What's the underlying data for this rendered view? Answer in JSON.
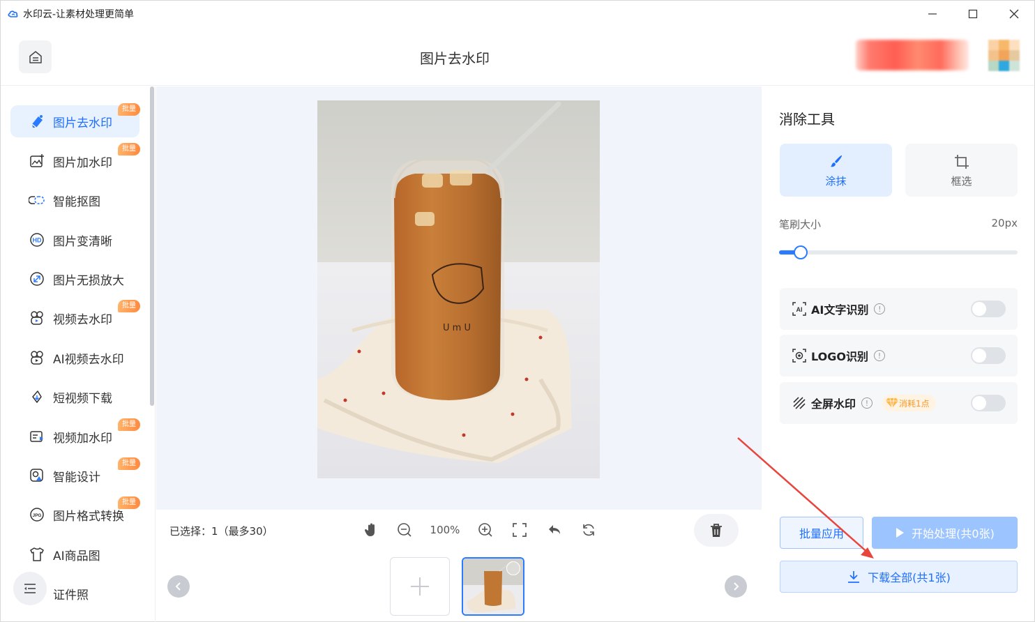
{
  "window": {
    "title": "水印云-让素材处理更简单",
    "controls": [
      "minimize-icon",
      "maximize-icon",
      "close-icon"
    ]
  },
  "header": {
    "page_title": "图片去水印",
    "home_icon": "home-icon"
  },
  "sidebar": {
    "items": [
      {
        "label": "图片去水印",
        "icon": "eraser-icon",
        "badge": "批量",
        "active": true
      },
      {
        "label": "图片加水印",
        "icon": "image-add-icon",
        "badge": "批量",
        "active": false
      },
      {
        "label": "智能抠图",
        "icon": "cutout-icon",
        "badge": "",
        "active": false
      },
      {
        "label": "图片变清晰",
        "icon": "hd-icon",
        "badge": "",
        "active": false
      },
      {
        "label": "图片无损放大",
        "icon": "enlarge-icon",
        "badge": "",
        "active": false
      },
      {
        "label": "视频去水印",
        "icon": "video-eraser-icon",
        "badge": "批量",
        "active": false
      },
      {
        "label": "AI视频去水印",
        "icon": "ai-video-icon",
        "badge": "",
        "active": false
      },
      {
        "label": "短视频下载",
        "icon": "link-download-icon",
        "badge": "",
        "active": false
      },
      {
        "label": "视频加水印",
        "icon": "video-add-icon",
        "badge": "批量",
        "active": false
      },
      {
        "label": "智能设计",
        "icon": "design-icon",
        "badge": "批量",
        "active": false
      },
      {
        "label": "图片格式转换",
        "icon": "jpg-icon",
        "badge": "批量",
        "active": false
      },
      {
        "label": "AI商品图",
        "icon": "tshirt-icon",
        "badge": "",
        "active": false
      },
      {
        "label": "证件照",
        "icon": "id-photo-icon",
        "badge": "",
        "active": false
      }
    ]
  },
  "workspace": {
    "selected_text": "已选择：1（最多30）",
    "zoom": "100%"
  },
  "right_panel": {
    "title": "消除工具",
    "tools": [
      {
        "label": "涂抹",
        "icon": "brush-icon",
        "active": true
      },
      {
        "label": "框选",
        "icon": "crop-icon",
        "active": false
      }
    ],
    "brush_size_label": "笔刷大小",
    "brush_size_value": "20px",
    "brush_level_fraction": 0.09,
    "options": [
      {
        "label": "AI文字识别",
        "icon": "ai-text-icon",
        "enabled": false
      },
      {
        "label": "LOGO识别",
        "icon": "logo-target-icon",
        "enabled": false
      },
      {
        "label": "全屏水印",
        "icon": "fullscreen-watermark-icon",
        "cost": "消耗1点",
        "enabled": false
      }
    ],
    "batch_apply_label": "批量应用",
    "start_label": "开始处理(共0张)",
    "download_label": "下载全部(共1张)"
  },
  "colors": {
    "accent": "#1f6fff",
    "badge": "#ff8a3d",
    "annotation_arrow": "#e8453c"
  }
}
